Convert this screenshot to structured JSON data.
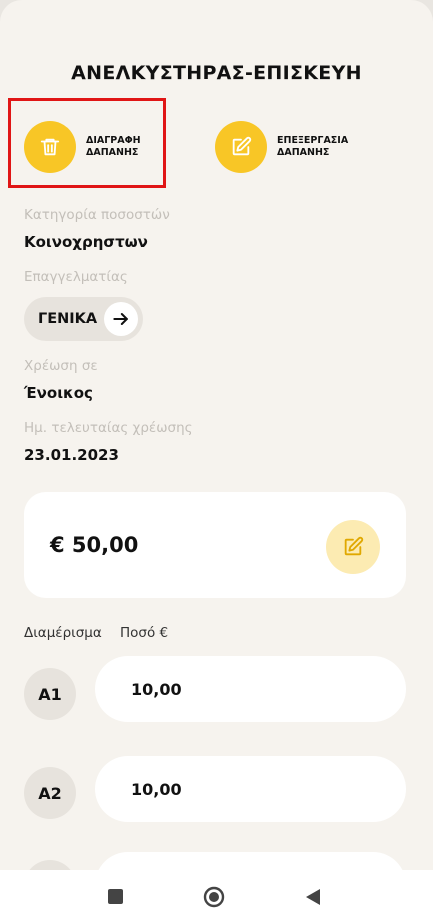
{
  "screen_title": "ΑΝΕΛΚΥΣΤΗΡΑΣ-ΕΠΙΣΚΕΥΗ",
  "actions": {
    "delete": {
      "line1": "ΔΙΑΓΡΑΦΗ",
      "line2": "ΔΑΠΑΝΗΣ",
      "icon": "trash-icon"
    },
    "edit": {
      "line1": "ΕΠΕΞΕΡΓΑΣΙΑ",
      "line2": "ΔΑΠΑΝΗΣ",
      "icon": "pencil-square-icon"
    }
  },
  "details": {
    "category_label": "Κατηγορία ποσοστών",
    "category_value": "Κοινοχρηστων",
    "professional_label": "Επαγγελματίας",
    "professional_value": "ΓΕΝΙΚΑ",
    "charge_label": "Χρέωση σε",
    "charge_value": "Ένοικος",
    "last_charge_label": "Ημ. τελευταίας χρέωσης",
    "last_charge_value": "23.01.2023"
  },
  "amount": {
    "value": "€ 50,00"
  },
  "table": {
    "col_apartment": "Διαμέρισμα",
    "col_amount": "Ποσό €",
    "rows": [
      {
        "apartment": "A1",
        "amount": "10,00"
      },
      {
        "apartment": "A2",
        "amount": "10,00"
      }
    ]
  },
  "colors": {
    "accent": "#f8c626",
    "accent_light": "#fcebb2",
    "background": "#f6f3ee",
    "highlight": "#e01515"
  }
}
